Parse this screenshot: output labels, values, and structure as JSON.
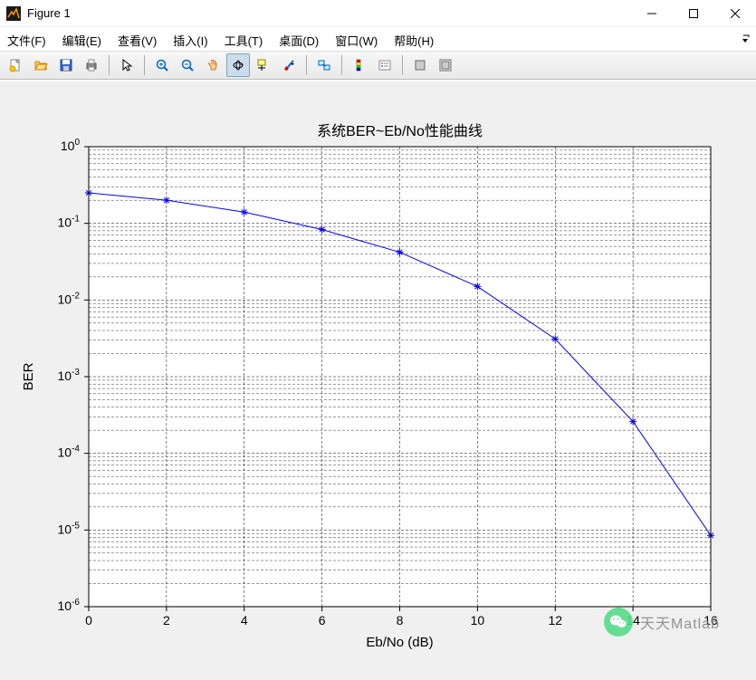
{
  "window": {
    "title": "Figure 1"
  },
  "menu": {
    "file": "文件(F)",
    "edit": "编辑(E)",
    "view": "查看(V)",
    "insert": "插入(I)",
    "tools": "工具(T)",
    "desktop": "桌面(D)",
    "window": "窗口(W)",
    "help": "帮助(H)"
  },
  "toolbar": {
    "new": "新建",
    "open": "打开",
    "save": "保存",
    "print": "打印",
    "cursor": "指针",
    "zoom_in": "放大",
    "zoom_out": "缩小",
    "pan": "平移",
    "rotate": "旋转",
    "datacursor": "数据游标",
    "brush": "刷选",
    "link": "链接",
    "colorbar": "颜色条",
    "legend": "图例",
    "hide": "隐藏",
    "show": "显示"
  },
  "watermark": {
    "text": "天天Matlab"
  },
  "chart_data": {
    "type": "line",
    "title": "系统BER~Eb/No性能曲线",
    "xlabel": "Eb/No (dB)",
    "ylabel": "BER",
    "xlim": [
      0,
      16
    ],
    "ylim": [
      1e-06,
      1
    ],
    "xticks": [
      0,
      2,
      4,
      6,
      8,
      10,
      12,
      14,
      16
    ],
    "yscale": "log",
    "x": [
      0,
      2,
      4,
      6,
      8,
      10,
      12,
      14,
      16
    ],
    "y": [
      0.25,
      0.2,
      0.14,
      0.083,
      0.042,
      0.015,
      0.0031,
      0.00026,
      8.5e-06
    ],
    "series_color": "#0000ff",
    "marker": "*"
  }
}
